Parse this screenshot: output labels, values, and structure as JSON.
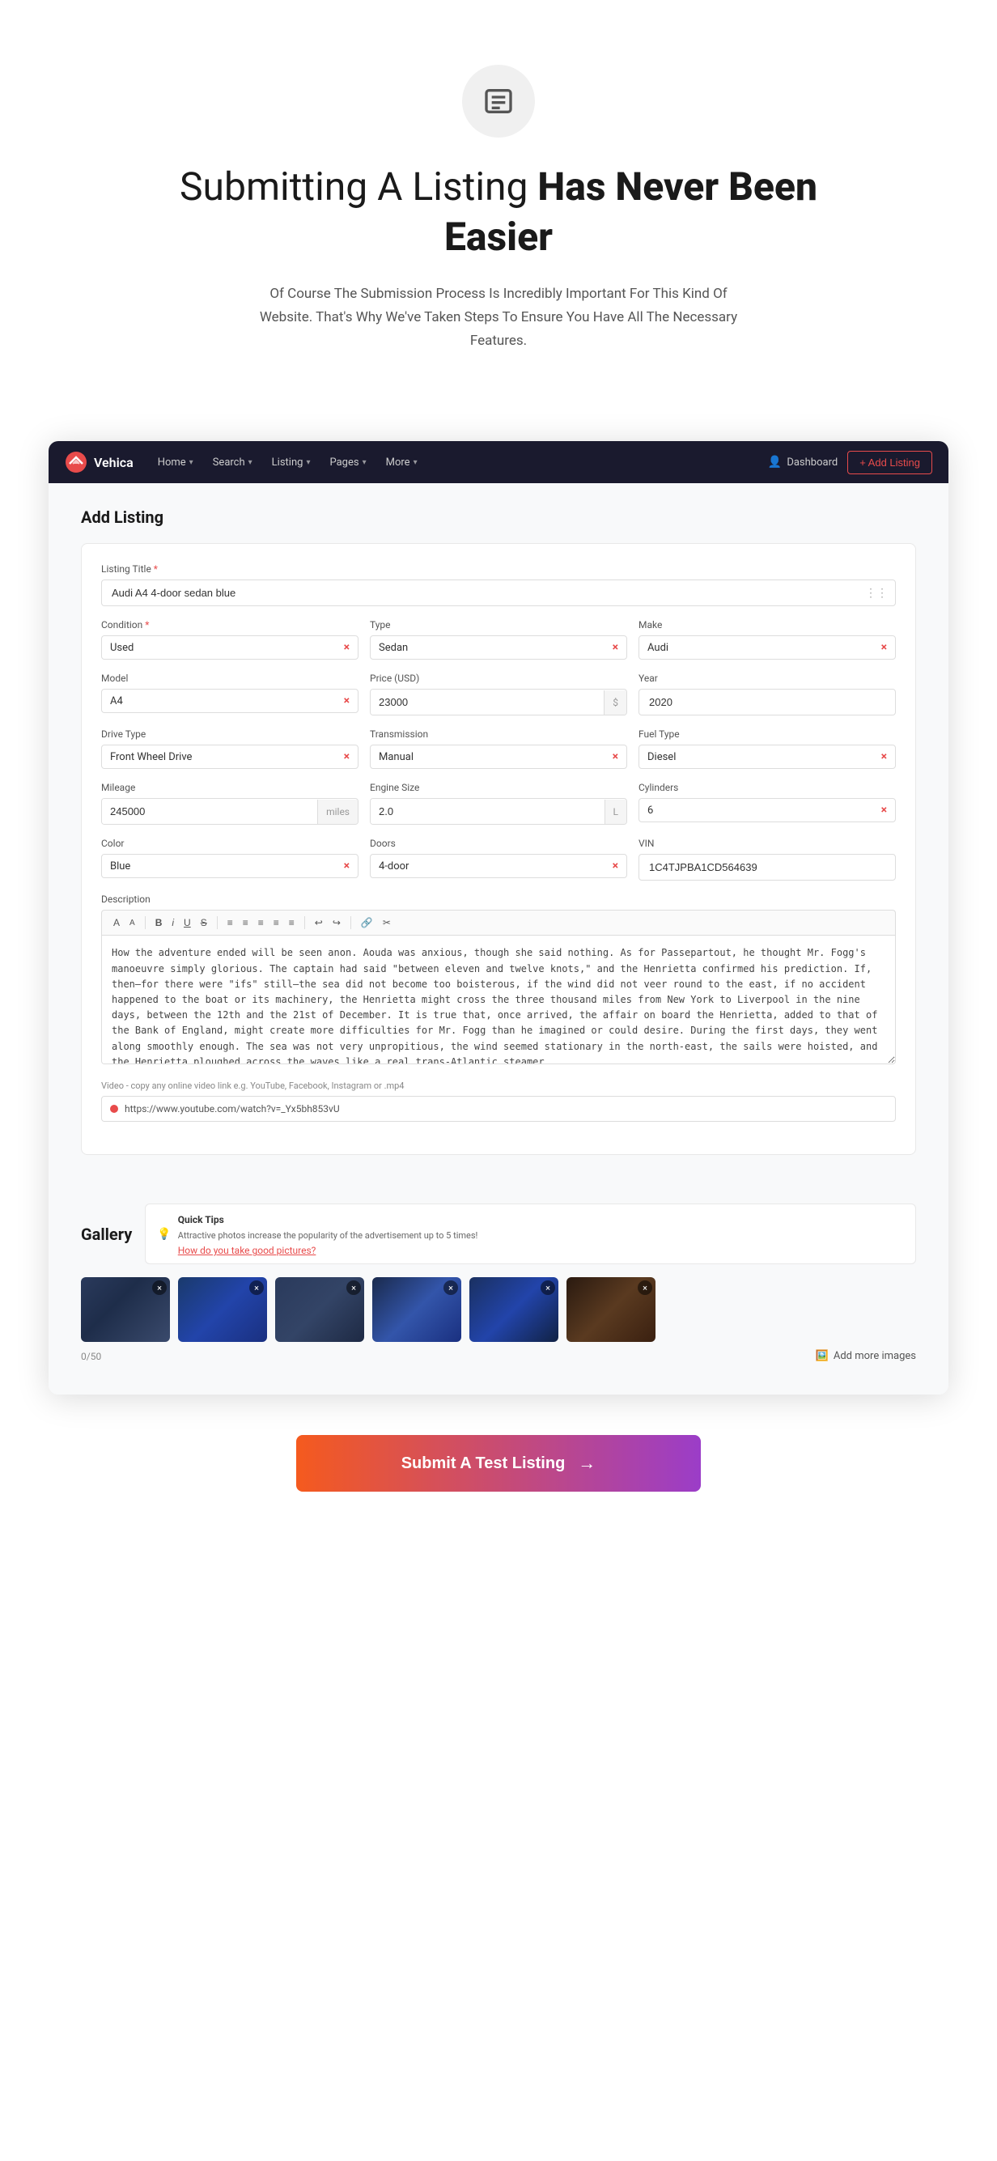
{
  "hero": {
    "title_normal": "Submitting A Listing ",
    "title_bold": "Has Never Been Easier",
    "description": "Of Course The Submission Process Is Incredibly Important For This Kind Of Website. That's Why We've Taken Steps To Ensure You Have All The Necessary Features."
  },
  "navbar": {
    "brand": "Vehica",
    "items": [
      {
        "label": "Home",
        "has_dropdown": true
      },
      {
        "label": "Search",
        "has_dropdown": true
      },
      {
        "label": "Listing",
        "has_dropdown": true
      },
      {
        "label": "Pages",
        "has_dropdown": true
      },
      {
        "label": "More",
        "has_dropdown": true
      }
    ],
    "dashboard": "Dashboard",
    "add_listing": "+ Add Listing"
  },
  "form": {
    "title": "Add Listing",
    "listing_title_label": "Listing Title",
    "listing_title_value": "Audi A4 4-door sedan blue",
    "condition_label": "Condition",
    "condition_value": "Used",
    "type_label": "Type",
    "type_value": "Sedan",
    "make_label": "Make",
    "make_value": "Audi",
    "model_label": "Model",
    "model_value": "A4",
    "price_label": "Price (USD)",
    "price_value": "23000",
    "price_suffix": "$",
    "year_label": "Year",
    "year_value": "2020",
    "drive_type_label": "Drive Type",
    "drive_type_value": "Front Wheel Drive",
    "transmission_label": "Transmission",
    "transmission_value": "Manual",
    "fuel_type_label": "Fuel Type",
    "fuel_type_value": "Diesel",
    "mileage_label": "Mileage",
    "mileage_value": "245000",
    "mileage_suffix": "miles",
    "engine_size_label": "Engine Size",
    "engine_size_value": "2.0",
    "engine_suffix": "L",
    "cylinders_label": "Cylinders",
    "cylinders_value": "6",
    "color_label": "Color",
    "color_value": "Blue",
    "doors_label": "Doors",
    "doors_value": "4-door",
    "vin_label": "VIN",
    "vin_value": "1C4TJPBA1CD564639",
    "description_label": "Description",
    "description_text": "How the adventure ended will be seen anon. Aouda was anxious, though she said nothing. As for Passepartout, he thought Mr. Fogg's manoeuvre simply glorious. The captain had said \"between eleven and twelve knots,\" and the Henrietta confirmed his prediction. If, then—for there were \"ifs\" still—the sea did not become too boisterous, if the wind did not veer round to the east, if no accident happened to the boat or its machinery, the Henrietta might cross the three thousand miles from New York to Liverpool in the nine days, between the 12th and the 21st of December. It is true that, once arrived, the affair on board the Henrietta, added to that of the Bank of England, might create more difficulties for Mr. Fogg than he imagined or could desire. During the first days, they went along smoothly enough. The sea was not very unpropitious, the wind seemed stationary in the north-east, the sails were hoisted, and the Henrietta ploughed across the waves like a real trans-Atlantic steamer.",
    "video_label": "Video - copy any online video link e.g. YouTube, Facebook, Instagram or .mp4",
    "video_url": "https://www.youtube.com/watch?v=_Yx5bh853vU"
  },
  "gallery": {
    "title": "Gallery",
    "tips_title": "Quick Tips",
    "tips_text": "Attractive photos increase the popularity of the advertisement up to 5 times!",
    "tips_link": "How do you take good pictures?",
    "image_count": "0/50",
    "add_more": "Add more images",
    "images": [
      {
        "id": 1,
        "css_class": "car-img-1"
      },
      {
        "id": 2,
        "css_class": "car-img-2"
      },
      {
        "id": 3,
        "css_class": "car-img-3"
      },
      {
        "id": 4,
        "css_class": "car-img-4"
      },
      {
        "id": 5,
        "css_class": "car-img-5"
      },
      {
        "id": 6,
        "css_class": "car-img-6"
      }
    ]
  },
  "submit": {
    "button_label": "Submit A Test Listing",
    "arrow": "→"
  },
  "toolbar_buttons": [
    "A",
    "A",
    "B",
    "i",
    "U",
    "S",
    "≡",
    "≡",
    "≡",
    "≡",
    "≡",
    "⬅",
    "➡",
    "↩",
    "↪",
    "🔗",
    "✂"
  ]
}
